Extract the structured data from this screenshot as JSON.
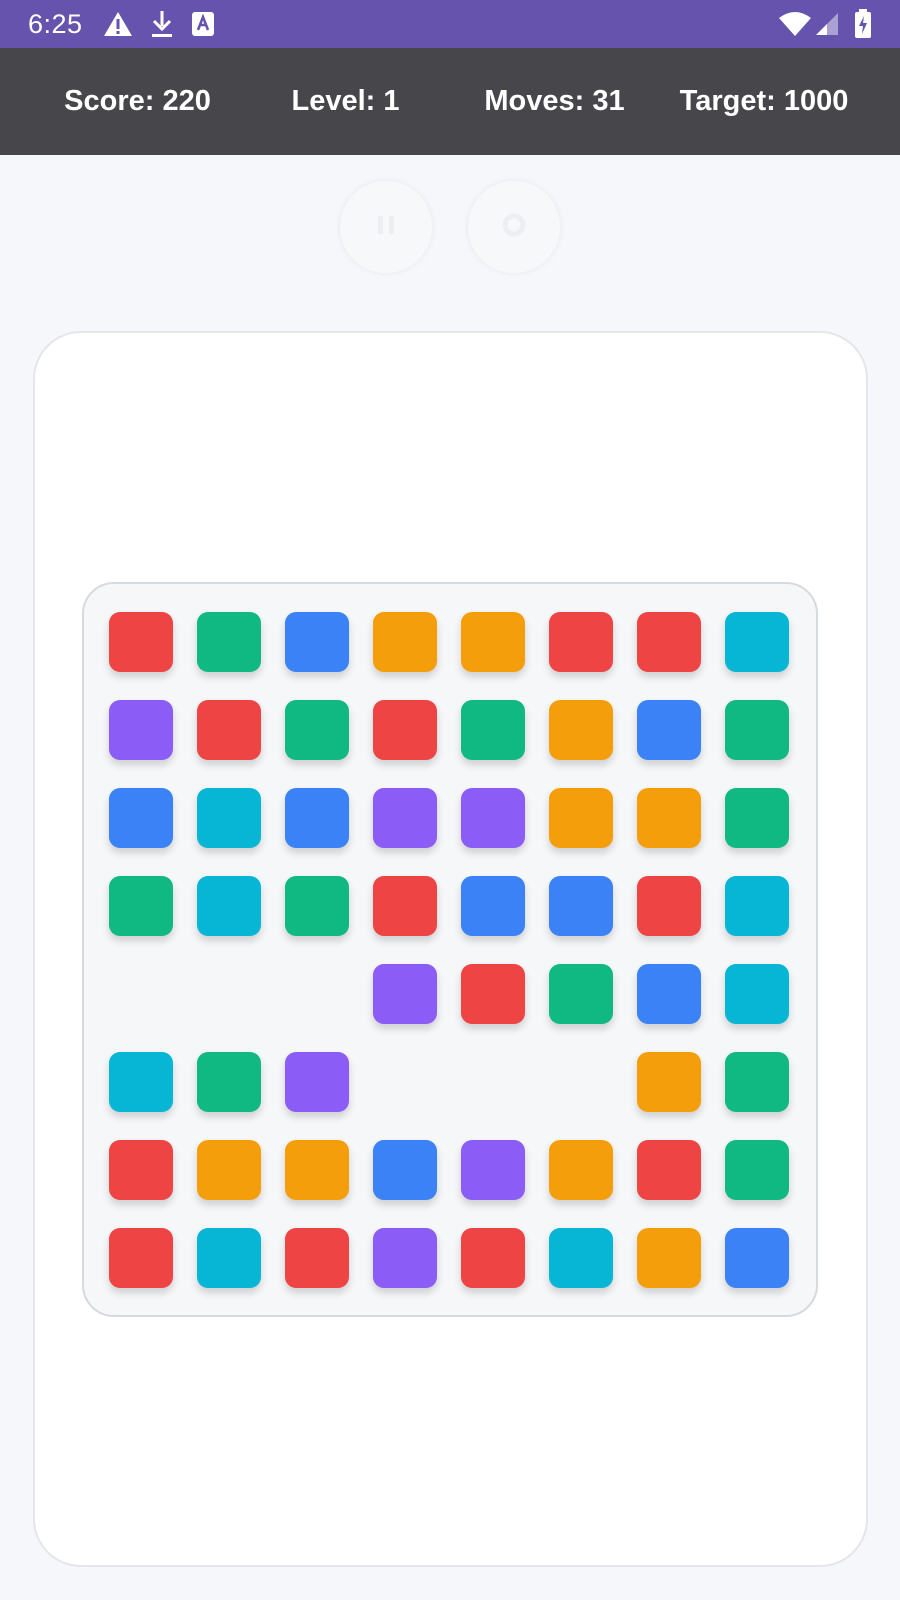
{
  "status_bar": {
    "time": "6:25",
    "left_icons": [
      "warning-icon",
      "download-icon",
      "text-a-icon"
    ],
    "right_icons": [
      "wifi-icon",
      "cell-signal-icon",
      "battery-charging-icon"
    ]
  },
  "header": {
    "score": "Score: 220",
    "level": "Level: 1",
    "moves": "Moves: 31",
    "target": "Target: 1000"
  },
  "controls": {
    "pause_icon": "pause-icon",
    "restart_icon": "restart-icon"
  },
  "colors": {
    "R": "#ef4444",
    "G": "#10b981",
    "B": "#3b82f6",
    "O": "#f59e0b",
    "P": "#8b5cf6",
    "C": "#06b6d4"
  },
  "color_names": {
    "R": "red",
    "G": "green",
    "B": "blue",
    "O": "orange",
    "P": "purple",
    "C": "cyan"
  },
  "board": {
    "rows": 8,
    "cols": 8,
    "cells": [
      [
        "R",
        "G",
        "B",
        "O",
        "O",
        "R",
        "R",
        "C"
      ],
      [
        "P",
        "R",
        "G",
        "R",
        "G",
        "O",
        "B",
        "G"
      ],
      [
        "B",
        "C",
        "B",
        "P",
        "P",
        "O",
        "O",
        "G"
      ],
      [
        "G",
        "C",
        "G",
        "R",
        "B",
        "B",
        "R",
        "C"
      ],
      [
        "",
        "",
        "",
        "P",
        "R",
        "G",
        "B",
        "C"
      ],
      [
        "C",
        "G",
        "P",
        "",
        "",
        "",
        "O",
        "G"
      ],
      [
        "R",
        "O",
        "O",
        "B",
        "P",
        "O",
        "R",
        "G"
      ],
      [
        "R",
        "C",
        "R",
        "P",
        "R",
        "C",
        "O",
        "B"
      ]
    ]
  }
}
